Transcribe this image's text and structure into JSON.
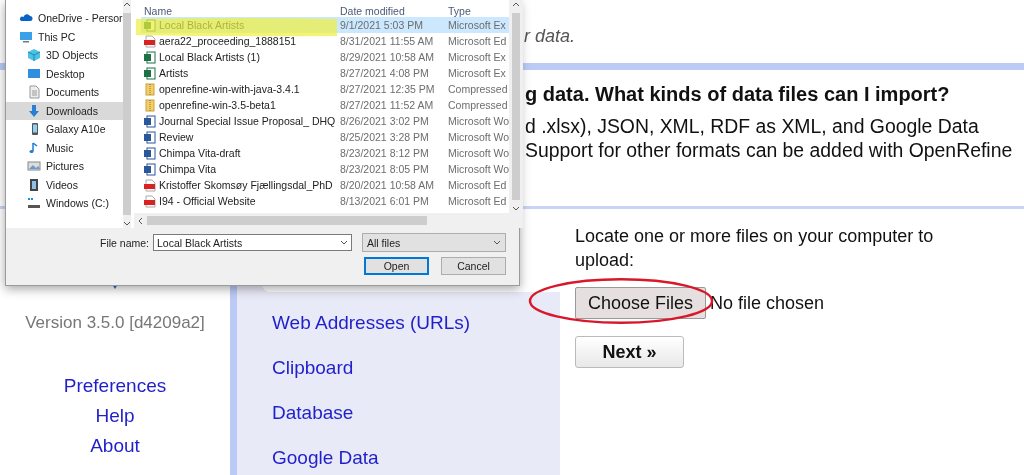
{
  "file_dialog": {
    "nav_items": [
      {
        "label": "OneDrive - Persor",
        "kind": "cloud",
        "selected": false
      },
      {
        "label": "This PC",
        "kind": "pc",
        "selected": false,
        "children": [
          {
            "label": "3D Objects",
            "kind": "cube",
            "selected": false
          },
          {
            "label": "Desktop",
            "kind": "desktop",
            "selected": false
          },
          {
            "label": "Documents",
            "kind": "documents",
            "selected": false
          },
          {
            "label": "Downloads",
            "kind": "downloads",
            "selected": true
          },
          {
            "label": "Galaxy A10e",
            "kind": "phone",
            "selected": false
          },
          {
            "label": "Music",
            "kind": "music",
            "selected": false
          },
          {
            "label": "Pictures",
            "kind": "pictures",
            "selected": false
          },
          {
            "label": "Videos",
            "kind": "videos",
            "selected": false
          },
          {
            "label": "Windows (C:)",
            "kind": "drive",
            "selected": false
          }
        ]
      }
    ],
    "columns": [
      "Name",
      "Date modified",
      "Type"
    ],
    "files": [
      {
        "name": "Local Black Artists",
        "date": "9/1/2021 5:03 PM",
        "type": "Microsoft Ex",
        "kind": "excel",
        "selected": true
      },
      {
        "name": "aera22_proceeding_1888151",
        "date": "8/31/2021 11:55 AM",
        "type": "Microsoft Ed",
        "kind": "pdf",
        "selected": false
      },
      {
        "name": "Local Black Artists (1)",
        "date": "8/29/2021 10:58 AM",
        "type": "Microsoft Ex",
        "kind": "excel",
        "selected": false
      },
      {
        "name": "Artists",
        "date": "8/27/2021 4:08 PM",
        "type": "Microsoft Ex",
        "kind": "excel",
        "selected": false
      },
      {
        "name": "openrefine-win-with-java-3.4.1",
        "date": "8/27/2021 12:35 PM",
        "type": "Compressed",
        "kind": "zip",
        "selected": false
      },
      {
        "name": "openrefine-win-3.5-beta1",
        "date": "8/27/2021 11:52 AM",
        "type": "Compressed",
        "kind": "zip",
        "selected": false
      },
      {
        "name": "Journal Special Issue Proposal_ DHQ",
        "date": "8/26/2021 3:02 PM",
        "type": "Microsoft Wo",
        "kind": "word",
        "selected": false
      },
      {
        "name": "Review",
        "date": "8/25/2021 3:28 PM",
        "type": "Microsoft Wo",
        "kind": "word",
        "selected": false
      },
      {
        "name": "Chimpa Vita-draft",
        "date": "8/23/2021 8:12 PM",
        "type": "Microsoft Wo",
        "kind": "word",
        "selected": false
      },
      {
        "name": "Chimpa Vita",
        "date": "8/23/2021 8:05 PM",
        "type": "Microsoft Wo",
        "kind": "word",
        "selected": false
      },
      {
        "name": "Kristoffer Skomsøy Fjællingsdal_PhD",
        "date": "8/20/2021 10:58 AM",
        "type": "Microsoft Ed",
        "kind": "pdf",
        "selected": false
      },
      {
        "name": "I94 - Official Website",
        "date": "8/13/2021 6:01 PM",
        "type": "Microsoft Ed",
        "kind": "pdf",
        "selected": false
      }
    ],
    "file_name_label": "File name:",
    "file_name": "Local Black Artists",
    "filter": "All files",
    "buttons": [
      {
        "label": "Open",
        "kind": "default"
      },
      {
        "label": "Cancel",
        "kind": "normal"
      }
    ]
  },
  "page": {
    "intro_fragment": "r data.",
    "question": "g data. What kinds of data files can I import?",
    "answer_lines": [
      "d .xlsx), JSON, XML, RDF as XML, and Google Data",
      "Support for other formats can be added with OpenRefine"
    ],
    "version": "Version 3.5.0 [d4209a2]",
    "footer_links": [
      "Preferences",
      "Help",
      "About"
    ],
    "sources": [
      {
        "label": "Web Addresses (URLs)",
        "selected": false
      },
      {
        "label": "Clipboard",
        "selected": false
      },
      {
        "label": "Database",
        "selected": false
      },
      {
        "label": "Google Data",
        "selected": false
      }
    ],
    "upload": {
      "prompt": "Locate one or more files on your computer to upload:",
      "choose_button": "Choose Files",
      "file_status": "No file chosen",
      "next_button": "Next »"
    }
  }
}
